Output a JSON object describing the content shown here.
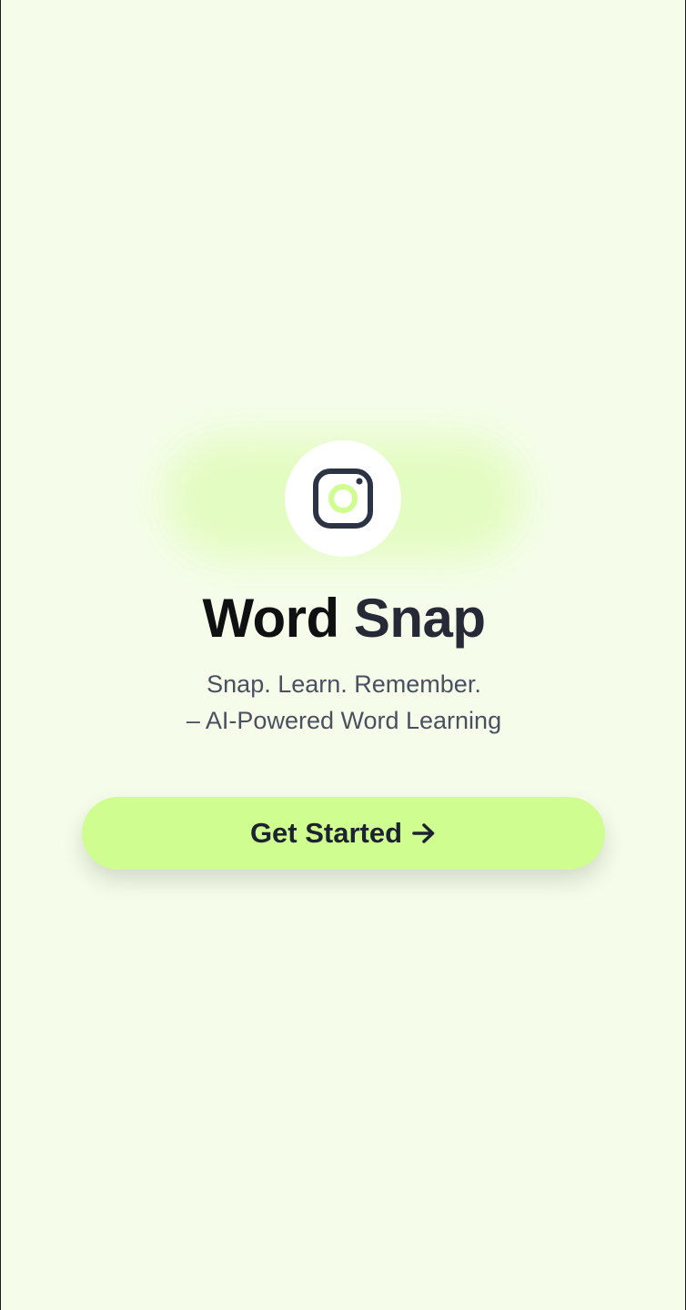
{
  "app": {
    "title_word1": "Word",
    "title_word2": "Snap",
    "tagline_line1": "Snap. Learn. Remember.",
    "tagline_line2": "– AI-Powered Word Learning"
  },
  "logo": {
    "icon": "camera-icon",
    "stroke_color": "#2b3345",
    "lens_color": "#cffd8f"
  },
  "cta": {
    "label": "Get Started",
    "icon": "arrow-right-icon",
    "background": "#cffd8f"
  },
  "colors": {
    "background": "#f5fdea",
    "accent": "#cffd8f",
    "glow": "#e2fcbf"
  }
}
